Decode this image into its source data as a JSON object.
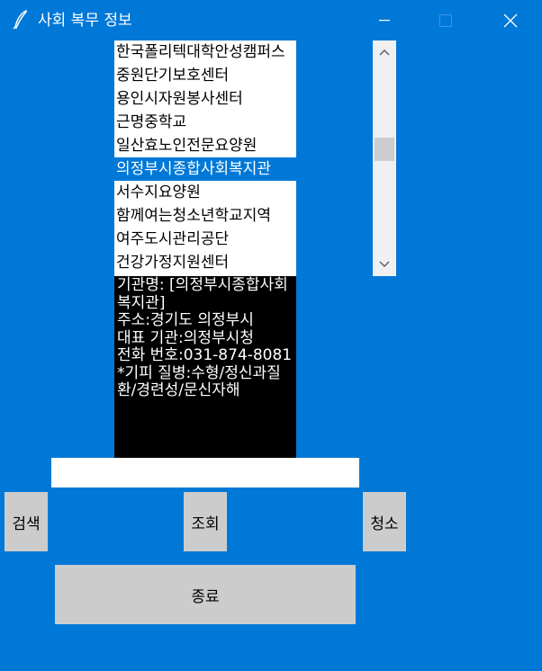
{
  "window": {
    "title": "사회 복무 정보",
    "minimize_glyph": "—",
    "close_glyph": "✕"
  },
  "listbox": {
    "items": [
      "한국폴리텍대학안성캠퍼스",
      "중원단기보호센터",
      "용인시자원봉사센터",
      "근명중학교",
      "일산효노인전문요양원",
      "의정부시종합사회복지관",
      "서수지요양원",
      "함께여는청소년학교지역",
      "여주도시관리공단",
      "건강가정지원센터"
    ],
    "selected_index": 5
  },
  "info": {
    "lines": [
      "기관명: [의정부시종합사회복지관]",
      "주소:경기도 의정부시",
      "대표 기관:의정부시청",
      "전화 번호:031-874-8081",
      "*기피 질병:수형/정신과질환/경련성/문신자해"
    ]
  },
  "search": {
    "value": ""
  },
  "buttons": {
    "search": "검색",
    "lookup": "조회",
    "clear": "청소",
    "exit": "종료"
  }
}
